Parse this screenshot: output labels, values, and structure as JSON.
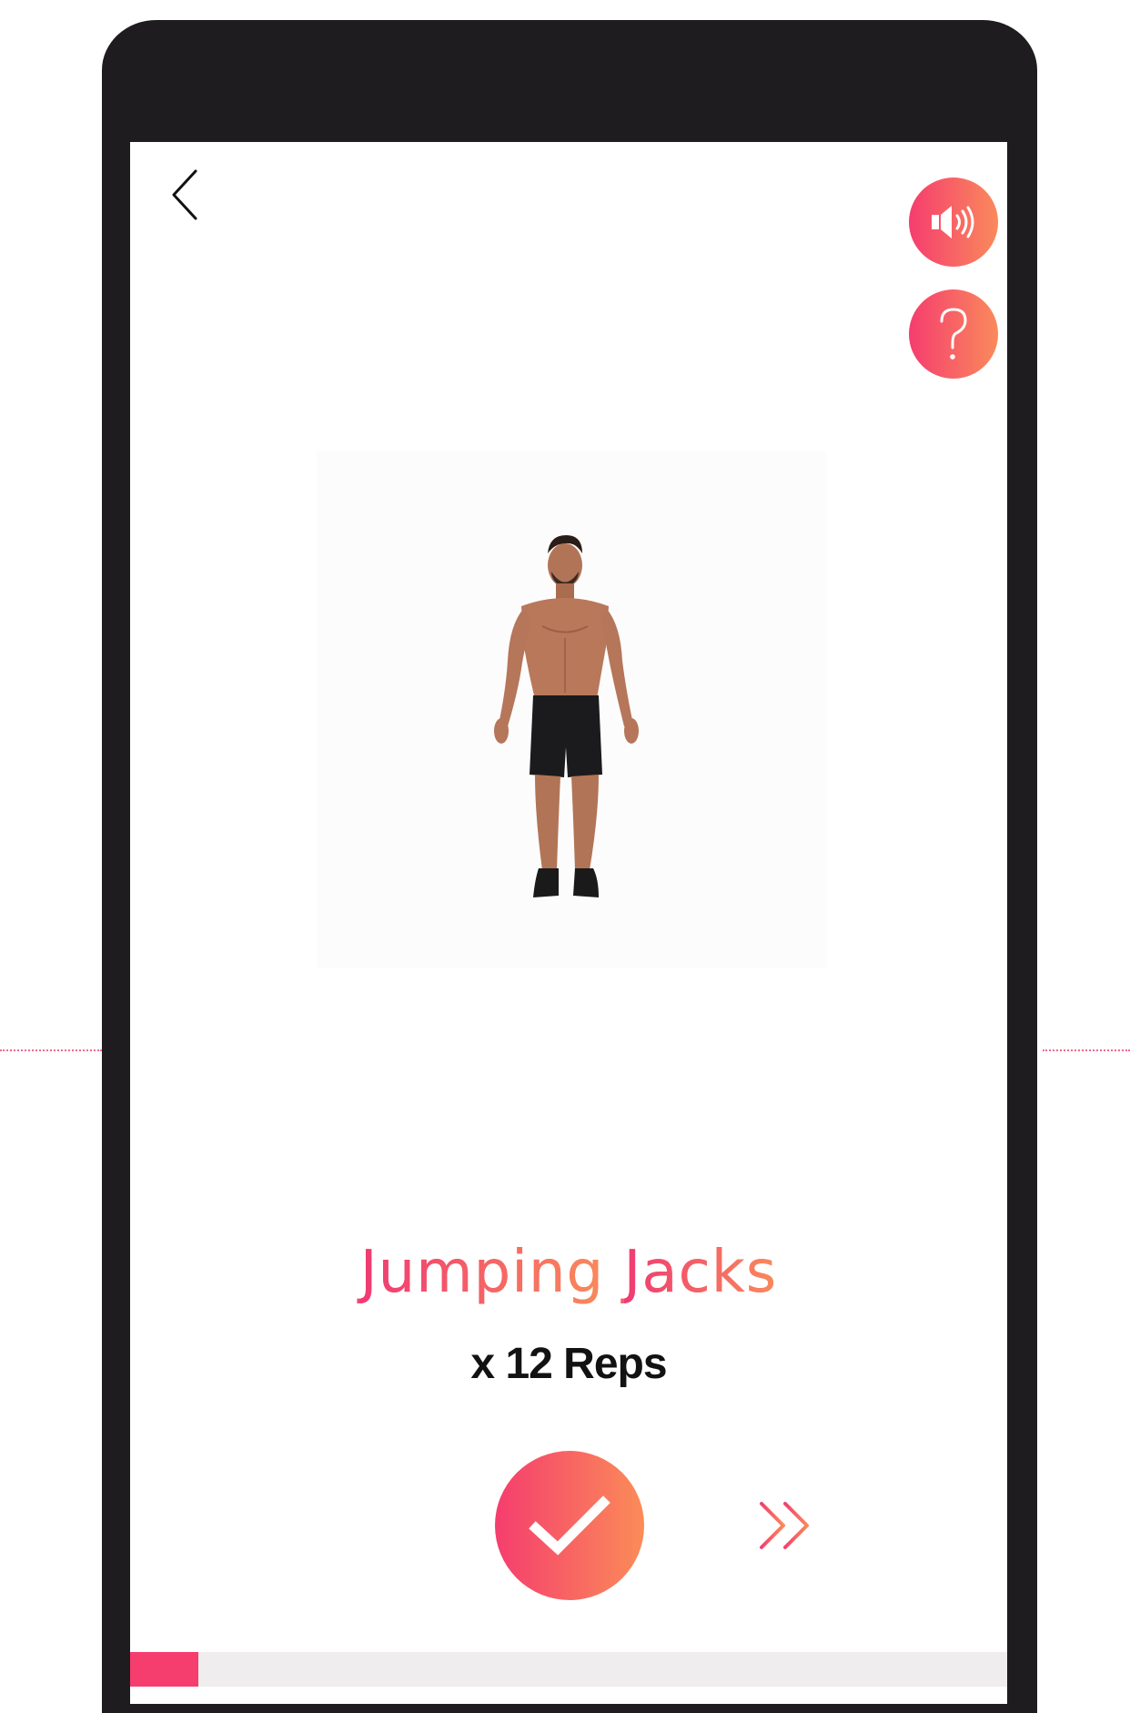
{
  "header": {
    "back_icon": "chevron-left-icon",
    "sound_icon": "speaker-icon",
    "help_icon": "question-mark-icon"
  },
  "exercise": {
    "name_part1": "Jumping",
    "name_part2": "Jacks",
    "reps": "x 12 Reps",
    "media": "person performing jumping jacks"
  },
  "actions": {
    "done_icon": "check-icon",
    "skip_icon": "double-chevron-right-icon"
  },
  "progress": {
    "fraction": 0.078
  },
  "colors": {
    "accent_start": "#f53d6e",
    "accent_end": "#fa8a5c",
    "frame": "#1e1c1e",
    "progress_track": "#efeded"
  }
}
